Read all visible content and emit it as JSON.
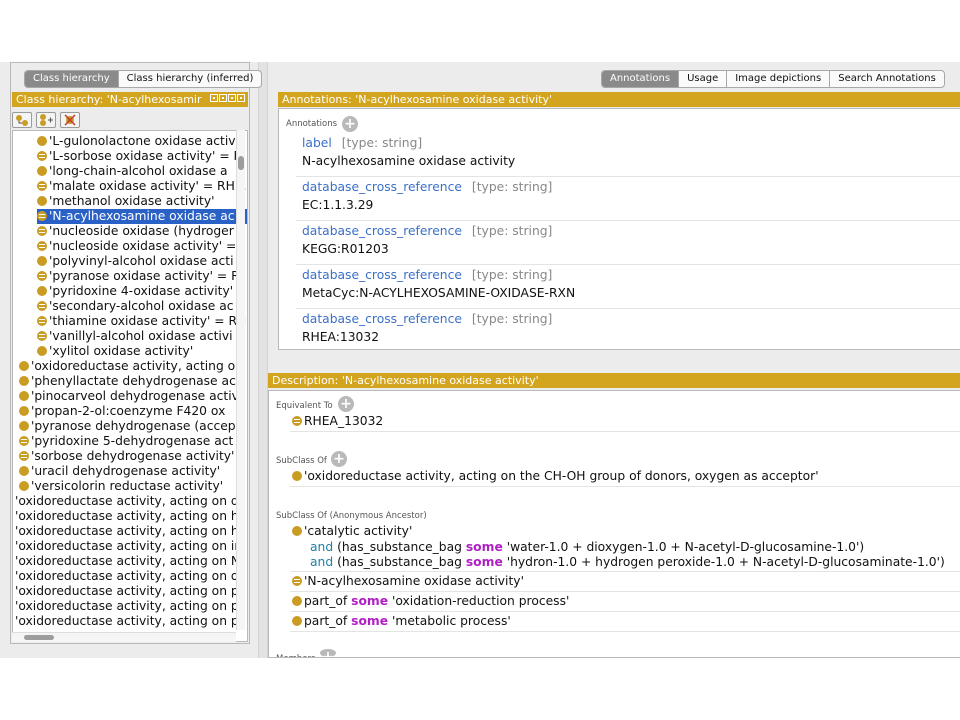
{
  "left_tabs": [
    "Class hierarchy",
    "Class hierarchy (inferred)"
  ],
  "class_hierarchy_header": "Class hierarchy: 'N-acylhexosamir",
  "toolbar_icons": [
    "add-subclass-icon",
    "add-sibling-icon",
    "delete-class-icon"
  ],
  "tree_items": [
    {
      "label": "'L-gulonolactone oxidase activ",
      "indent": 1,
      "eq": false
    },
    {
      "label": "'L-sorbose oxidase activity' = F",
      "indent": 1,
      "eq": true
    },
    {
      "label": "'long-chain-alcohol oxidase a",
      "indent": 1,
      "eq": false
    },
    {
      "label": "'malate oxidase activity' = RHE.",
      "indent": 1,
      "eq": true
    },
    {
      "label": "'methanol oxidase activity'",
      "indent": 1,
      "eq": false
    },
    {
      "label": "'N-acylhexosamine oxidase ac",
      "indent": 1,
      "eq": true,
      "selected": true
    },
    {
      "label": "'nucleoside oxidase (hydroger",
      "indent": 1,
      "eq": true
    },
    {
      "label": "'nucleoside oxidase activity' =",
      "indent": 1,
      "eq": true
    },
    {
      "label": "'polyvinyl-alcohol oxidase acti",
      "indent": 1,
      "eq": false
    },
    {
      "label": "'pyranose oxidase activity' = RI",
      "indent": 1,
      "eq": true
    },
    {
      "label": "'pyridoxine 4-oxidase activity'",
      "indent": 1,
      "eq": false
    },
    {
      "label": "'secondary-alcohol oxidase ac",
      "indent": 1,
      "eq": true
    },
    {
      "label": "'thiamine oxidase activity' = RH",
      "indent": 1,
      "eq": true
    },
    {
      "label": "'vanillyl-alcohol oxidase activi",
      "indent": 1,
      "eq": true
    },
    {
      "label": "'xylitol oxidase activity'",
      "indent": 1,
      "eq": false
    },
    {
      "label": "'oxidoreductase activity, acting oi",
      "indent": 0,
      "eq": false
    },
    {
      "label": "'phenyllactate dehydrogenase act",
      "indent": 0,
      "eq": false
    },
    {
      "label": "'pinocarveol dehydrogenase activ",
      "indent": 0,
      "eq": false
    },
    {
      "label": "'propan-2-ol:coenzyme F420 ox",
      "indent": 0,
      "eq": false
    },
    {
      "label": "'pyranose dehydrogenase (accept",
      "indent": 0,
      "eq": false
    },
    {
      "label": "'pyridoxine 5-dehydrogenase act",
      "indent": 0,
      "eq": true
    },
    {
      "label": "'sorbose dehydrogenase activity'",
      "indent": 0,
      "eq": true
    },
    {
      "label": "'uracil dehydrogenase activity'",
      "indent": 0,
      "eq": false
    },
    {
      "label": "'versicolorin reductase activity'",
      "indent": 0,
      "eq": false
    },
    {
      "label": "'oxidoreductase activity, acting on d",
      "indent": -1,
      "eq": false
    },
    {
      "label": "'oxidoreductase activity, acting on h",
      "indent": -1,
      "eq": false
    },
    {
      "label": "'oxidoreductase activity, acting on h",
      "indent": -1,
      "eq": false
    },
    {
      "label": "'oxidoreductase activity, acting on ir",
      "indent": -1,
      "eq": false
    },
    {
      "label": "'oxidoreductase activity, acting on N",
      "indent": -1,
      "eq": false
    },
    {
      "label": "'oxidoreductase activity, acting on o",
      "indent": -1,
      "eq": false
    },
    {
      "label": "'oxidoreductase activity, acting on p",
      "indent": -1,
      "eq": false
    },
    {
      "label": "'oxidoreductase activity, acting on p",
      "indent": -1,
      "eq": false
    },
    {
      "label": "'oxidoreductase activity, acting on p",
      "indent": -1,
      "eq": false
    }
  ],
  "right_tabs": [
    "Annotations",
    "Usage",
    "Image depictions",
    "Search Annotations"
  ],
  "annotations_header": "Annotations: 'N-acylhexosamine oxidase activity'",
  "annotations_label": "Annotations",
  "annotations": [
    {
      "property": "label",
      "type": "[type: string]",
      "value": "N-acylhexosamine oxidase activity"
    },
    {
      "property": "database_cross_reference",
      "type": "[type: string]",
      "value": "EC:1.1.3.29"
    },
    {
      "property": "database_cross_reference",
      "type": "[type: string]",
      "value": "KEGG:R01203"
    },
    {
      "property": "database_cross_reference",
      "type": "[type: string]",
      "value": "MetaCyc:N-ACYLHEXOSAMINE-OXIDASE-RXN"
    },
    {
      "property": "database_cross_reference",
      "type": "[type: string]",
      "value": "RHEA:13032"
    }
  ],
  "description_header": "Description: 'N-acylhexosamine oxidase activity'",
  "equivalent_to_label": "Equivalent To",
  "equivalent_to_value": "RHEA_13032",
  "subclass_of_label": "SubClass Of",
  "subclass_of_value": "'oxidoreductase activity, acting on the CH-OH group of donors, oxygen as acceptor'",
  "anon_ancestor_label": "SubClass Of (Anonymous Ancestor)",
  "anon_ancestor": {
    "catalytic": "'catalytic activity'",
    "and1_kw": "and",
    "and1_pre": "(has_substance_bag",
    "some_kw": "some",
    "and1_post": "'water-1.0 + dioxygen-1.0 + N-acetyl-D-glucosamine-1.0')",
    "and2_kw": "and",
    "and2_pre": "(has_substance_bag",
    "and2_post": "'hydron-1.0 + hydrogen peroxide-1.0 + N-acetyl-D-glucosaminate-1.0')",
    "self_ref": "'N-acylhexosamine oxidase activity'",
    "part_of": "part_of",
    "partof1_target": "'oxidation-reduction process'",
    "partof2_target": "'metabolic process'"
  },
  "members_label": "Members"
}
